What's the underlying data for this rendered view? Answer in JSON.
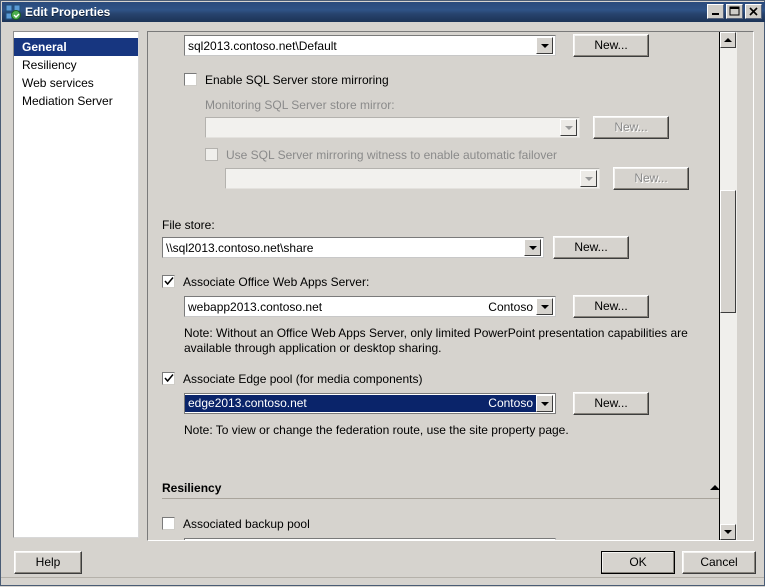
{
  "window": {
    "title": "Edit Properties",
    "icon": "lync-topology-icon",
    "controls": [
      {
        "name": "minimize",
        "glyph": "minimize-icon"
      },
      {
        "name": "maximize",
        "glyph": "maximize-icon"
      },
      {
        "name": "close",
        "glyph": "close-icon"
      }
    ]
  },
  "nav": {
    "items": [
      {
        "label": "General",
        "selected": true
      },
      {
        "label": "Resiliency",
        "selected": false
      },
      {
        "label": "Web services",
        "selected": false
      },
      {
        "label": "Mediation Server",
        "selected": false
      }
    ]
  },
  "general": {
    "sql_store": {
      "value": "sql2013.contoso.net\\Default",
      "new_button": "New..."
    },
    "enable_mirroring": {
      "label": "Enable SQL Server store mirroring",
      "checked": false
    },
    "monitoring_mirror": {
      "label": "Monitoring SQL Server store mirror:",
      "value": "",
      "new_button": "New...",
      "disabled": true
    },
    "mirroring_witness": {
      "label": "Use SQL Server mirroring witness to enable automatic failover",
      "checked": false,
      "value": "",
      "new_button": "New...",
      "disabled": true
    },
    "file_store": {
      "label": "File store:",
      "value": "\\\\sql2013.contoso.net\\share",
      "new_button": "New..."
    },
    "office_web_apps": {
      "label": "Associate Office Web Apps Server:",
      "checked": true,
      "value": "webapp2013.contoso.net",
      "suffix": "Contoso",
      "new_button": "New...",
      "note": "Note: Without an Office Web Apps Server, only limited PowerPoint presentation capabilities are available through application or desktop sharing."
    },
    "edge_pool": {
      "label": "Associate Edge pool (for media components)",
      "checked": true,
      "value": "edge2013.contoso.net",
      "suffix": "Contoso",
      "new_button": "New...",
      "selected": true,
      "note": "Note: To view or change the federation route, use the site property page."
    }
  },
  "resiliency": {
    "heading": "Resiliency",
    "collapse_icon": "chevron-up-icon",
    "backup_pool": {
      "label": "Associated backup pool",
      "checked": false
    }
  },
  "footer": {
    "help": "Help",
    "ok": "OK",
    "cancel": "Cancel"
  },
  "colors": {
    "titlebar": "#2f5386",
    "selection": "#0a246a",
    "nav_selected": "#173680",
    "dialog_face": "#d6d3ce"
  }
}
